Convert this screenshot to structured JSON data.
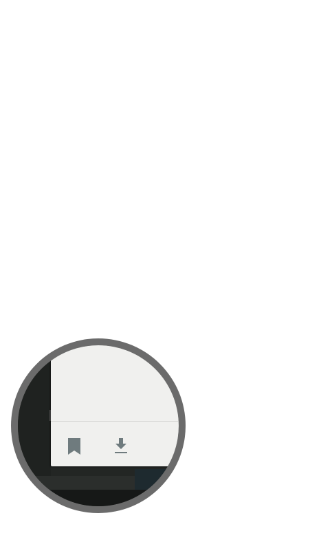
{
  "magnifier": {
    "colors": {
      "ring": "#6b6b6b",
      "sheet": "#f0f0ee",
      "icon": "#6f7b7e",
      "background": "#232624"
    },
    "actions": [
      {
        "name": "bookmark",
        "icon": "bookmark-icon"
      },
      {
        "name": "download",
        "icon": "download-icon"
      }
    ]
  }
}
